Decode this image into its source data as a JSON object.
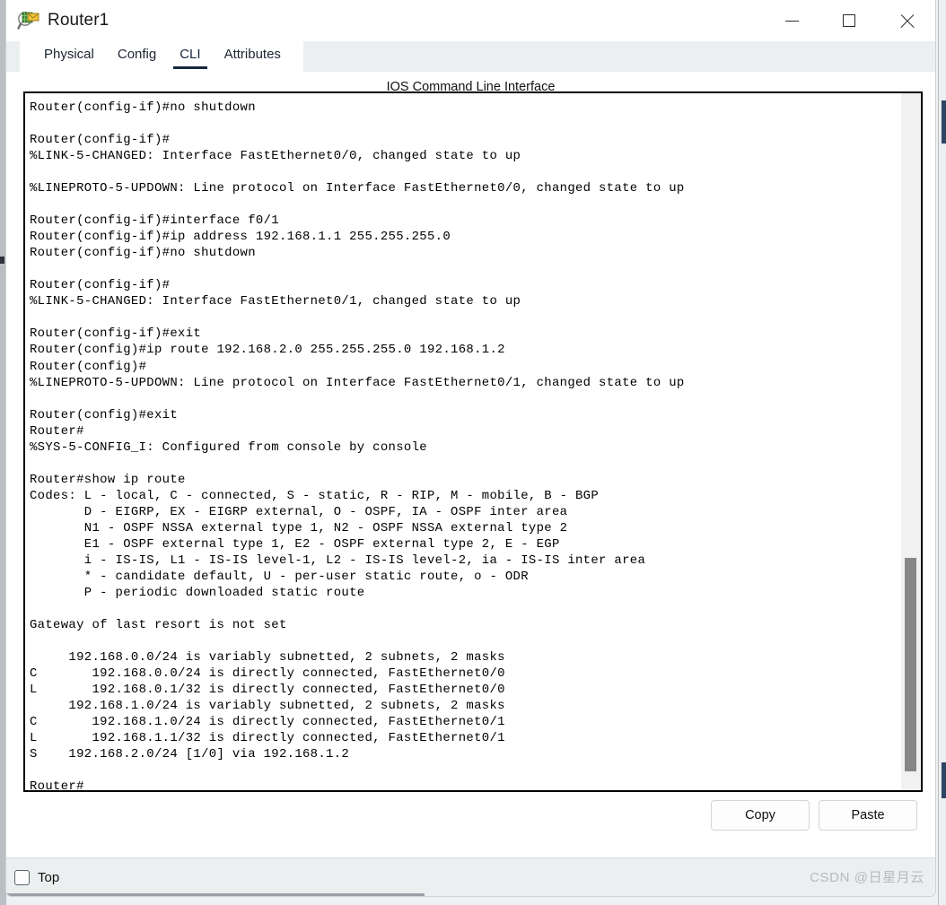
{
  "window": {
    "title": "Router1",
    "app_icon": "packet-tracer-device-icon",
    "controls": {
      "minimize": "minimize-icon",
      "maximize": "maximize-icon",
      "close": "close-icon"
    }
  },
  "tabs": [
    {
      "label": "Physical",
      "active": false
    },
    {
      "label": "Config",
      "active": false
    },
    {
      "label": "CLI",
      "active": true
    },
    {
      "label": "Attributes",
      "active": false
    }
  ],
  "cli": {
    "header": "IOS Command Line Interface",
    "output": "Router(config-if)#no shutdown\n\nRouter(config-if)#\n%LINK-5-CHANGED: Interface FastEthernet0/0, changed state to up\n\n%LINEPROTO-5-UPDOWN: Line protocol on Interface FastEthernet0/0, changed state to up\n\nRouter(config-if)#interface f0/1\nRouter(config-if)#ip address 192.168.1.1 255.255.255.0\nRouter(config-if)#no shutdown\n\nRouter(config-if)#\n%LINK-5-CHANGED: Interface FastEthernet0/1, changed state to up\n\nRouter(config-if)#exit\nRouter(config)#ip route 192.168.2.0 255.255.255.0 192.168.1.2\nRouter(config)#\n%LINEPROTO-5-UPDOWN: Line protocol on Interface FastEthernet0/1, changed state to up\n\nRouter(config)#exit\nRouter#\n%SYS-5-CONFIG_I: Configured from console by console\n\nRouter#show ip route\nCodes: L - local, C - connected, S - static, R - RIP, M - mobile, B - BGP\n       D - EIGRP, EX - EIGRP external, O - OSPF, IA - OSPF inter area\n       N1 - OSPF NSSA external type 1, N2 - OSPF NSSA external type 2\n       E1 - OSPF external type 1, E2 - OSPF external type 2, E - EGP\n       i - IS-IS, L1 - IS-IS level-1, L2 - IS-IS level-2, ia - IS-IS inter area\n       * - candidate default, U - per-user static route, o - ODR\n       P - periodic downloaded static route\n\nGateway of last resort is not set\n\n     192.168.0.0/24 is variably subnetted, 2 subnets, 2 masks\nC       192.168.0.0/24 is directly connected, FastEthernet0/0\nL       192.168.0.1/32 is directly connected, FastEthernet0/0\n     192.168.1.0/24 is variably subnetted, 2 subnets, 2 masks\nC       192.168.1.0/24 is directly connected, FastEthernet0/1\nL       192.168.1.1/32 is directly connected, FastEthernet0/1\nS    192.168.2.0/24 [1/0] via 192.168.1.2\n\nRouter#"
  },
  "actions": {
    "copy_label": "Copy",
    "paste_label": "Paste"
  },
  "footer": {
    "top_checkbox_label": "Top",
    "top_checkbox_checked": false,
    "watermark": "CSDN @日星月云"
  },
  "colors": {
    "accent": "#17263d",
    "tab_bar_bg": "#eceff0",
    "terminal_border": "#000000",
    "scrollbar_thumb": "#868686",
    "watermark_text": "#b7babd"
  }
}
